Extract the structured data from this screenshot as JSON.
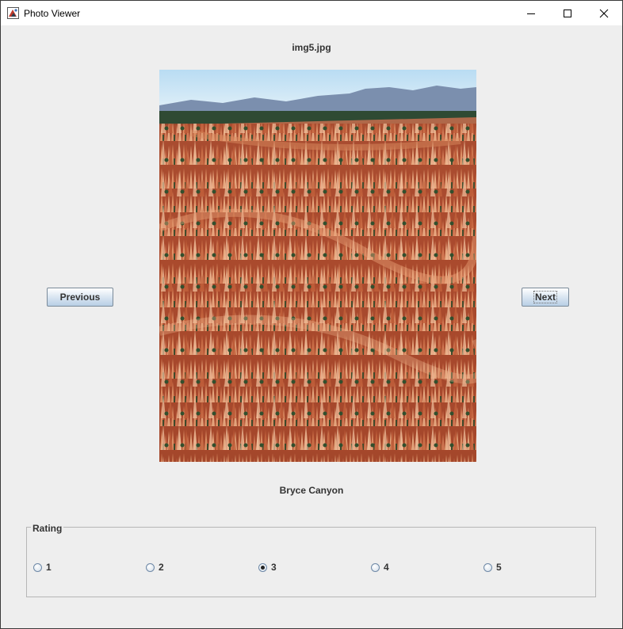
{
  "window": {
    "title": "Photo Viewer",
    "controls": {
      "minimize": "minimize",
      "maximize": "maximize",
      "close": "close"
    }
  },
  "photo": {
    "filename": "img5.jpg",
    "caption": "Bryce Canyon",
    "description_icon": "landscape-photo"
  },
  "nav": {
    "previous_label": "Previous",
    "next_label": "Next"
  },
  "rating": {
    "legend": "Rating",
    "options": [
      "1",
      "2",
      "3",
      "4",
      "5"
    ],
    "selected": "3"
  },
  "colors": {
    "window_bg": "#eeeeee",
    "button_border": "#7a8a99",
    "text": "#333333"
  }
}
